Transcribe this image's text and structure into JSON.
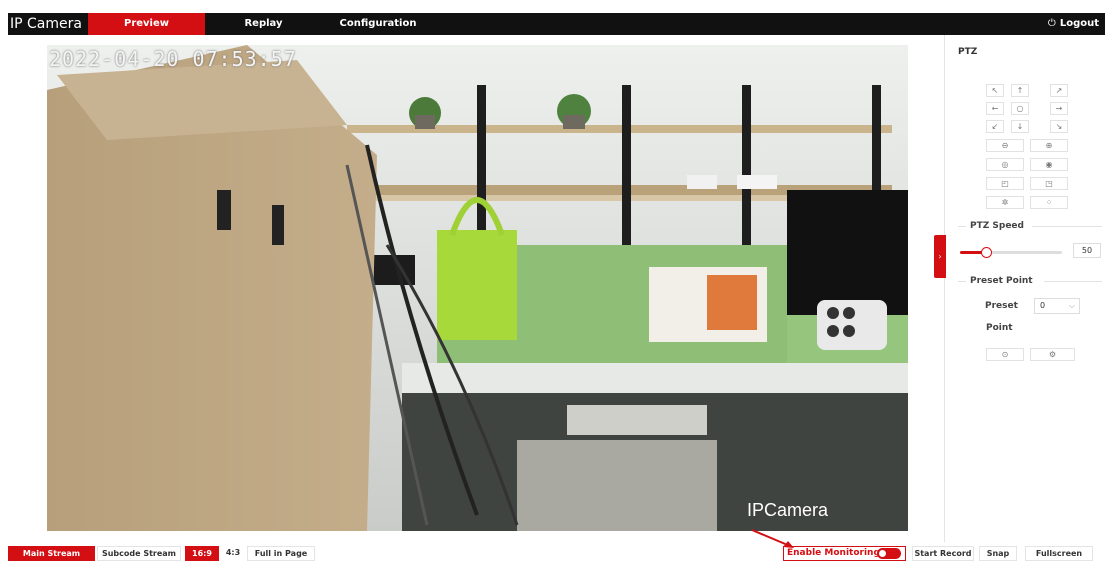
{
  "header": {
    "brand": "IP Camera",
    "nav": [
      {
        "label": "Preview",
        "active": true
      },
      {
        "label": "Replay",
        "active": false
      },
      {
        "label": "Configuration",
        "active": false
      }
    ],
    "logout_label": "Logout",
    "logout_icon": "power-icon"
  },
  "video": {
    "osd_timestamp": "2022-04-20 07:53:57",
    "osd_name": "IPCamera"
  },
  "ptz": {
    "title": "PTZ",
    "directions": [
      "↖",
      "↑",
      "↗",
      "←",
      "○",
      "→",
      "↙",
      "↓",
      "↘"
    ],
    "controls": [
      {
        "left": "zoom-out-icon",
        "right": "zoom-in-icon",
        "left_glyph": "⊖",
        "right_glyph": "⊕"
      },
      {
        "left": "focus-near-icon",
        "right": "focus-far-icon",
        "left_glyph": "◎",
        "right_glyph": "◉"
      },
      {
        "left": "iris-close-icon",
        "right": "iris-open-icon",
        "left_glyph": "◰",
        "right_glyph": "◳"
      },
      {
        "left": "light-icon",
        "right": "auto-focus-icon",
        "left_glyph": "✲",
        "right_glyph": "⁘"
      }
    ],
    "speed_label": "PTZ Speed",
    "speed_value": "50",
    "speed_fraction": 0.5,
    "preset_section_label": "Preset Point",
    "preset_label_line1": "Preset",
    "preset_label_line2": "Point",
    "preset_value": "0",
    "preset_actions": [
      {
        "icon": "call-preset-icon",
        "glyph": "⊙"
      },
      {
        "icon": "preset-settings-icon",
        "glyph": "⚙"
      }
    ],
    "collapse_glyph": "›"
  },
  "toolbar": {
    "streams": [
      {
        "label": "Main Stream",
        "active": true
      },
      {
        "label": "Subcode Stream",
        "active": false
      }
    ],
    "ratios": [
      {
        "label": "16:9",
        "active": true
      },
      {
        "label": "4:3",
        "active": false
      },
      {
        "label": "Full in Page",
        "active": false
      }
    ],
    "enable_monitoring_label": "Enable Monitoring",
    "enable_monitoring_on": true,
    "start_record_label": "Start Record",
    "snap_label": "Snap",
    "fullscreen_label": "Fullscreen"
  },
  "colors": {
    "accent": "#d40f14",
    "nav_bg": "#111111"
  }
}
